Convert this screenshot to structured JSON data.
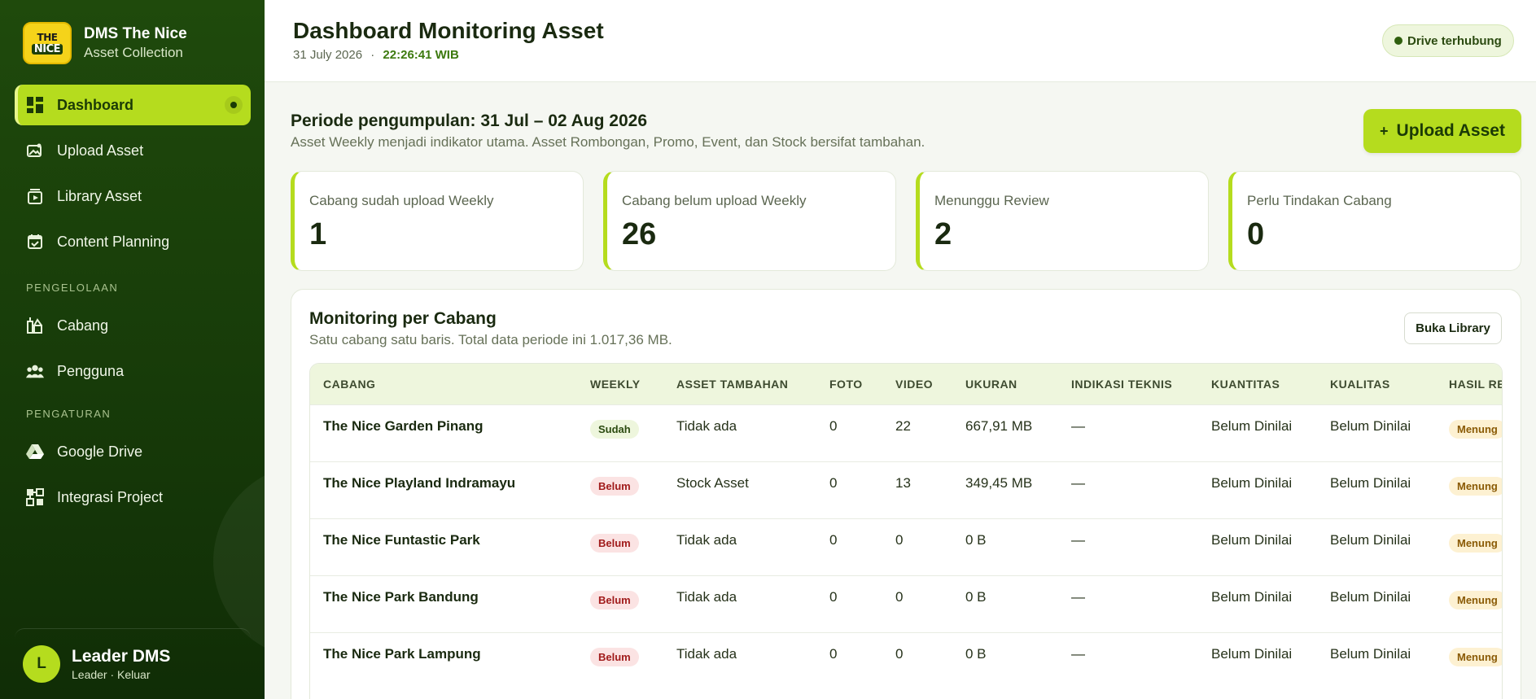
{
  "brand": {
    "logo_top": "THE",
    "logo_bottom": "NICE",
    "name": "DMS The Nice",
    "subtitle": "Asset Collection"
  },
  "sidebar": {
    "main_items": [
      {
        "label": "Dashboard",
        "icon": "dashboard-icon",
        "active": true
      },
      {
        "label": "Upload Asset",
        "icon": "image-upload-icon"
      },
      {
        "label": "Library Asset",
        "icon": "library-icon"
      },
      {
        "label": "Content Planning",
        "icon": "calendar-icon"
      }
    ],
    "section_manage": "PENGELOLAAN",
    "manage_items": [
      {
        "label": "Cabang",
        "icon": "branch-icon"
      },
      {
        "label": "Pengguna",
        "icon": "users-icon"
      }
    ],
    "section_settings": "PENGATURAN",
    "settings_items": [
      {
        "label": "Google Drive",
        "icon": "drive-icon"
      },
      {
        "label": "Integrasi Project",
        "icon": "integration-icon"
      }
    ]
  },
  "user": {
    "initial": "L",
    "name": "Leader DMS",
    "role": "Leader · Keluar"
  },
  "header": {
    "title": "Dashboard Monitoring Asset",
    "date": "31 July 2026",
    "separator": "·",
    "time": "22:26:41 WIB",
    "drive_status": "Drive terhubung"
  },
  "period": {
    "title": "Periode pengumpulan: 31 Jul – 02 Aug 2026",
    "subtitle": "Asset Weekly menjadi indikator utama. Asset Rombongan, Promo, Event, dan Stock bersifat tambahan.",
    "upload_label": "Upload Asset",
    "upload_plus": "+"
  },
  "stats": [
    {
      "label": "Cabang sudah upload Weekly",
      "value": "1"
    },
    {
      "label": "Cabang belum upload Weekly",
      "value": "26"
    },
    {
      "label": "Menunggu Review",
      "value": "2"
    },
    {
      "label": "Perlu Tindakan Cabang",
      "value": "0"
    }
  ],
  "monitor": {
    "title": "Monitoring per Cabang",
    "subtitle": "Satu cabang satu baris. Total data periode ini 1.017,36 MB.",
    "library_button": "Buka Library",
    "columns": [
      "CABANG",
      "WEEKLY",
      "ASSET TAMBAHAN",
      "FOTO",
      "VIDEO",
      "UKURAN",
      "INDIKASI TEKNIS",
      "KUANTITAS",
      "KUALITAS",
      "HASIL RE"
    ],
    "rows": [
      {
        "cabang": "The Nice Garden Pinang",
        "weekly": "Sudah",
        "weekly_status": "sudah",
        "tambahan": "Tidak ada",
        "foto": "0",
        "video": "22",
        "ukuran": "667,91 MB",
        "teknis": "—",
        "kuantitas": "Belum Dinilai",
        "kualitas": "Belum Dinilai",
        "hasil": "Menung"
      },
      {
        "cabang": "The Nice Playland Indramayu",
        "weekly": "Belum",
        "weekly_status": "belum",
        "tambahan": "Stock Asset",
        "foto": "0",
        "video": "13",
        "ukuran": "349,45 MB",
        "teknis": "—",
        "kuantitas": "Belum Dinilai",
        "kualitas": "Belum Dinilai",
        "hasil": "Menung"
      },
      {
        "cabang": "The Nice Funtastic Park",
        "weekly": "Belum",
        "weekly_status": "belum",
        "tambahan": "Tidak ada",
        "foto": "0",
        "video": "0",
        "ukuran": "0 B",
        "teknis": "—",
        "kuantitas": "Belum Dinilai",
        "kualitas": "Belum Dinilai",
        "hasil": "Menung"
      },
      {
        "cabang": "The Nice Park Bandung",
        "weekly": "Belum",
        "weekly_status": "belum",
        "tambahan": "Tidak ada",
        "foto": "0",
        "video": "0",
        "ukuran": "0 B",
        "teknis": "—",
        "kuantitas": "Belum Dinilai",
        "kualitas": "Belum Dinilai",
        "hasil": "Menung"
      },
      {
        "cabang": "The Nice Park Lampung",
        "weekly": "Belum",
        "weekly_status": "belum",
        "tambahan": "Tidak ada",
        "foto": "0",
        "video": "0",
        "ukuran": "0 B",
        "teknis": "—",
        "kuantitas": "Belum Dinilai",
        "kualitas": "Belum Dinilai",
        "hasil": "Menung"
      }
    ]
  },
  "colors": {
    "sidebar": "#1f4a0c",
    "accent": "#b5dc1e",
    "danger_pill": "#fbe3e3",
    "success_pill": "#eef6dd"
  }
}
